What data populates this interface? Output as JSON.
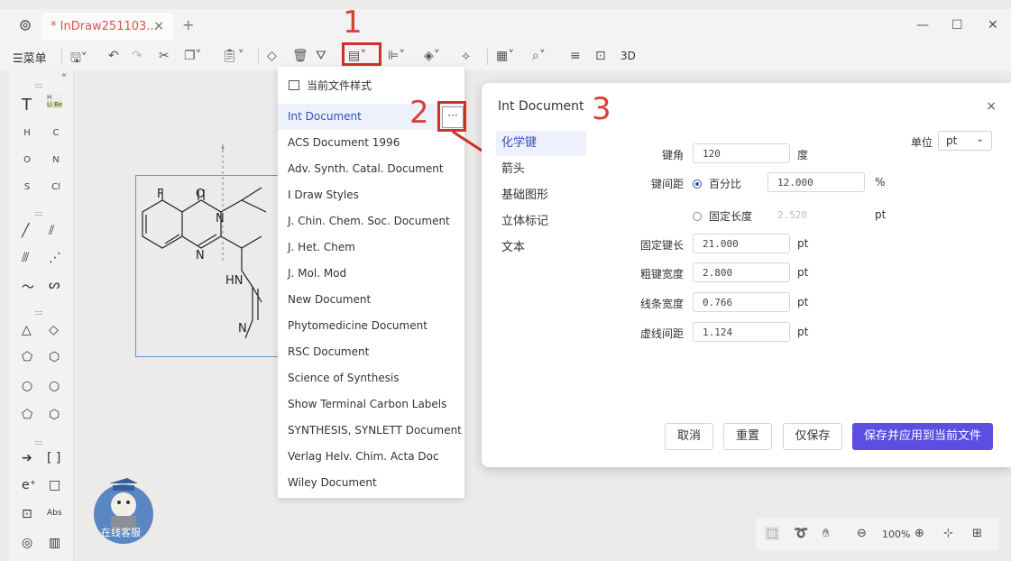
{
  "tab": {
    "title": "* InDraw251103...",
    "close": "×",
    "add": "+"
  },
  "window": {
    "minimize": "—",
    "maximize": "☐",
    "close": "✕"
  },
  "toolbar": {
    "menu_label": "☰菜单",
    "three_d": "3D"
  },
  "palette": {
    "text_tool": "T",
    "element_hint_top": "H",
    "element_hint_bottom": "Li Be",
    "elements": [
      "H",
      "C",
      "O",
      "N",
      "S",
      "Cl"
    ],
    "collapse": "«"
  },
  "steps": {
    "one": "1",
    "two": "2",
    "three": "3"
  },
  "dropdown": {
    "header": "当前文件样式",
    "items": [
      "Int Document",
      "ACS Document 1996",
      "Adv. Synth. Catal. Document",
      "I Draw Styles",
      "J. Chin. Chem. Soc. Document",
      "J. Het. Chem",
      "J. Mol. Mod",
      "New Document",
      "Phytomedicine Document",
      "RSC Document",
      "Science of Synthesis",
      "Show Terminal Carbon Labels",
      "SYNTHESIS, SYNLETT Document",
      "Verlag Helv. Chim. Acta Doc",
      "Wiley Document"
    ],
    "more": "···"
  },
  "dialog": {
    "title": "Int Document",
    "close": "×",
    "nav": [
      "化学键",
      "箭头",
      "基础图形",
      "立体标记",
      "文本"
    ],
    "unit_label": "单位",
    "unit_value": "pt",
    "fields": {
      "bond_angle_label": "键角",
      "bond_angle_value": "120",
      "bond_angle_unit": "度",
      "bond_spacing_label": "键间距",
      "percent_option": "百分比",
      "percent_value": "12.000",
      "percent_unit": "%",
      "fixed_length_option": "固定长度",
      "fixed_length_value": "2.520",
      "fixed_length_unit": "pt",
      "fixed_bond_length_label": "固定键长",
      "fixed_bond_length_value": "21.000",
      "fixed_bond_length_unit": "pt",
      "bold_width_label": "粗键宽度",
      "bold_width_value": "2.800",
      "bold_width_unit": "pt",
      "line_width_label": "线条宽度",
      "line_width_value": "0.766",
      "line_width_unit": "pt",
      "dash_spacing_label": "虚线间距",
      "dash_spacing_value": "1.124",
      "dash_spacing_unit": "pt"
    },
    "buttons": {
      "cancel": "取消",
      "reset": "重置",
      "save_only": "仅保存",
      "save_apply": "保存并应用到当前文件"
    }
  },
  "molecule_labels": {
    "F": "F",
    "O": "O",
    "N1": "N",
    "N2": "N",
    "HN": "HN",
    "N3": "N"
  },
  "view_bar": {
    "zoom": "100%"
  },
  "mascot": {
    "label": "在线客服"
  },
  "colors": {
    "accent": "#5b4ee0",
    "highlight": "#d9413a",
    "active_bg": "#edf1fb",
    "selection": "#6d8fd8"
  }
}
